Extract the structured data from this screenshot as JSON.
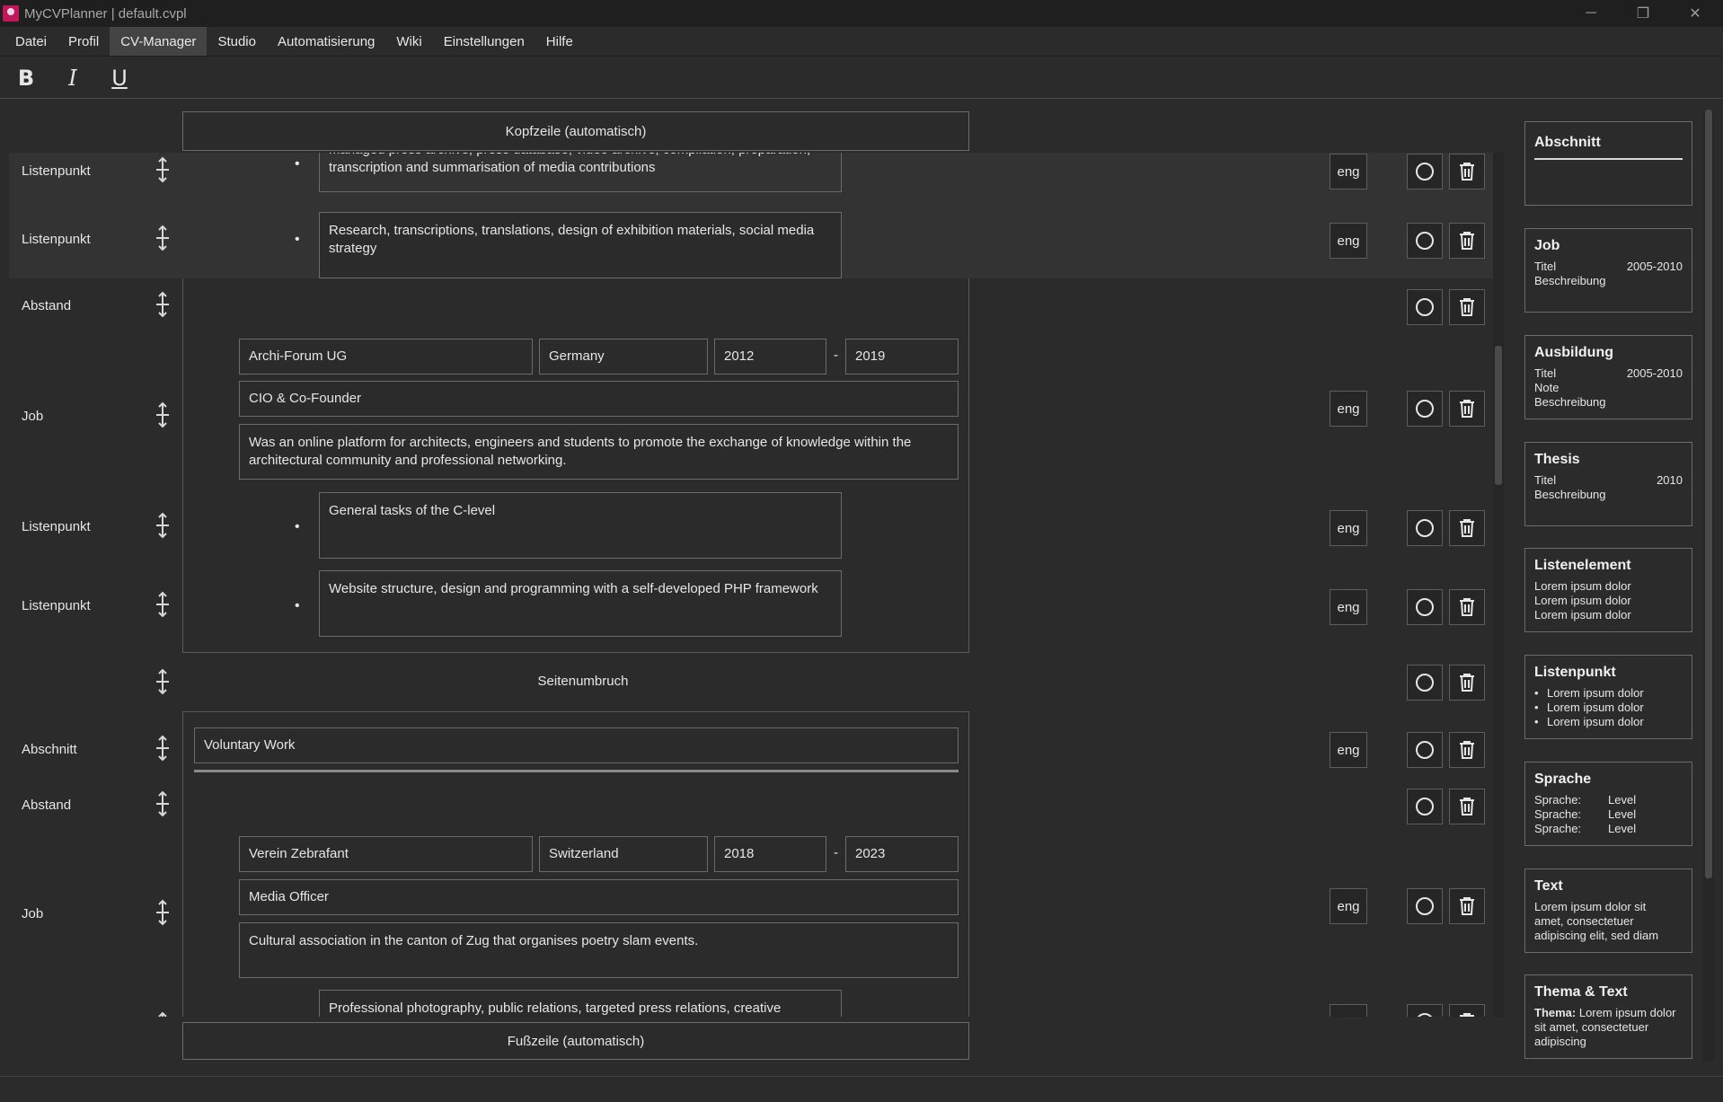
{
  "window": {
    "title": "MyCVPlanner | default.cvpl",
    "minimize": "─",
    "restore": "❐",
    "close": "✕"
  },
  "menu": [
    "Datei",
    "Profil",
    "CV-Manager",
    "Studio",
    "Automatisierung",
    "Wiki",
    "Einstellungen",
    "Hilfe"
  ],
  "toolbar": {
    "bold": "B",
    "italic": "I",
    "underline": "U"
  },
  "editor": {
    "header": "Kopfzeile (automatisch)",
    "footer": "Fußzeile (automatisch)",
    "page_break": "Seitenumbruch",
    "lang": "eng",
    "dash": "-",
    "bullet": "•",
    "labels": {
      "listenpunkt": "Listenpunkt",
      "abstand": "Abstand",
      "job": "Job",
      "abschnitt": "Abschnitt"
    },
    "items": {
      "lp1_text": "managed press archive, press database, video archive, compilation, preparation, transcription and summarisation of media contributions",
      "lp2_text": "Research, transcriptions, translations, design of exhibition materials, social media strategy",
      "job1": {
        "company": "Archi-Forum UG",
        "country": "Germany",
        "from": "2012",
        "to": "2019",
        "title": "CIO & Co-Founder",
        "description": "Was an online platform for architects, engineers and students to promote the exchange of knowledge within the architectural community and professional networking."
      },
      "lp3_text": "General tasks of the C-level",
      "lp4_text": "Website structure, design and programming with a self-developed PHP framework",
      "section_title": "Voluntary Work",
      "job2": {
        "company": "Verein Zebrafant",
        "country": "Switzerland",
        "from": "2018",
        "to": "2023",
        "title": "Media Officer",
        "description": "Cultural association in the canton of Zug that organises poetry slam events."
      },
      "lp5_text": "Professional photography, public relations, targeted press relations, creative advertising and strategic"
    }
  },
  "sidebar": {
    "abschnitt": {
      "title": "Abschnitt"
    },
    "job": {
      "title": "Job",
      "l1": "Titel",
      "r1": "2005-2010",
      "l2": "Beschreibung"
    },
    "ausbildung": {
      "title": "Ausbildung",
      "l1": "Titel",
      "r1": "2005-2010",
      "l2": "Note",
      "l3": "Beschreibung"
    },
    "thesis": {
      "title": "Thesis",
      "l1": "Titel",
      "r1": "2010",
      "l2": "Beschreibung"
    },
    "listenelement": {
      "title": "Listenelement",
      "lines": [
        "Lorem ipsum dolor",
        "Lorem ipsum dolor",
        "Lorem ipsum dolor"
      ]
    },
    "listenpunkt": {
      "title": "Listenpunkt",
      "lines": [
        "Lorem ipsum dolor",
        "Lorem ipsum dolor",
        "Lorem ipsum dolor"
      ]
    },
    "sprache": {
      "title": "Sprache",
      "label": "Sprache:",
      "level": "Level"
    },
    "text": {
      "title": "Text",
      "body": "Lorem ipsum dolor sit amet, consectetuer adipiscing elit, sed diam"
    },
    "thema": {
      "title": "Thema & Text",
      "bold": "Thema:",
      "body": " Lorem ipsum dolor sit amet, consectetuer adipiscing"
    }
  }
}
